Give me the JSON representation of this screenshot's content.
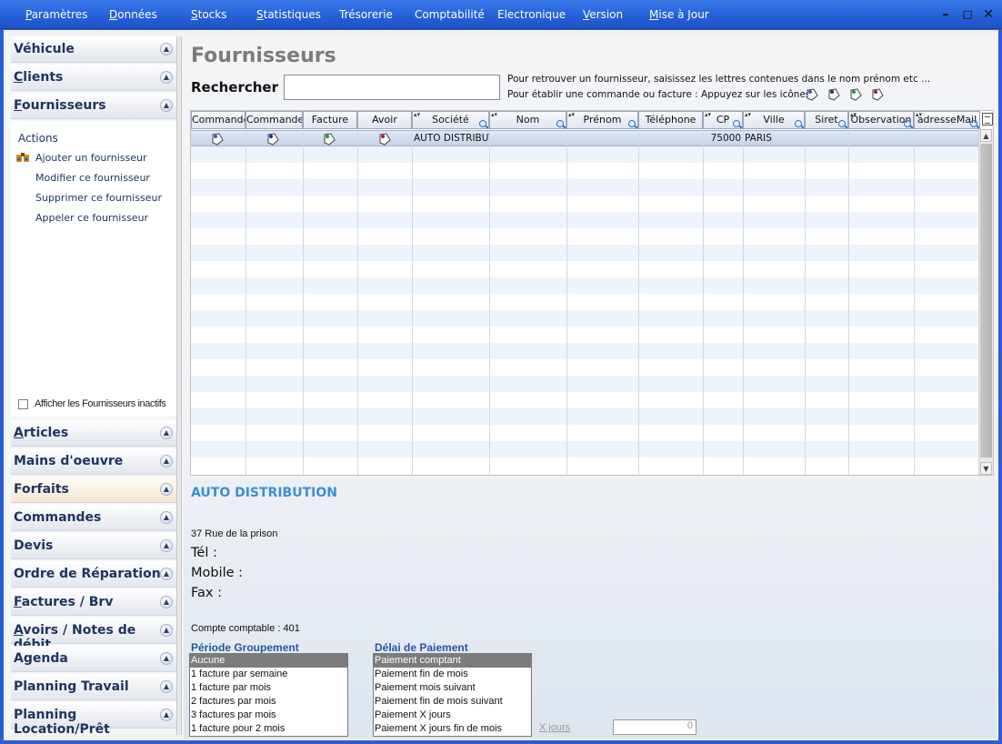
{
  "menu": {
    "items": [
      {
        "label": "Paramètres",
        "hotkey": "P",
        "rest": "aramètres"
      },
      {
        "label": "Données",
        "hotkey": "D",
        "rest": "onnées"
      },
      {
        "label": "Stocks",
        "hotkey": "S",
        "rest": "tocks"
      },
      {
        "label": "Statistiques",
        "hotkey": "S",
        "rest": "tatistiques"
      },
      {
        "label": "Trésorerie",
        "hotkey": "",
        "rest": "Trésorerie"
      },
      {
        "label": "Comptabilité",
        "hotkey": "",
        "rest": "Comptabilité"
      },
      {
        "label": "Electronique",
        "hotkey": "",
        "rest": "Electronique"
      },
      {
        "label": "Version",
        "hotkey": "V",
        "rest": "ersion"
      },
      {
        "label": "Mise à Jour",
        "hotkey": "M",
        "rest": "ise à Jour"
      }
    ],
    "window_buttons": {
      "minimize": "–",
      "maximize": "◻",
      "close": "✕"
    }
  },
  "sidebar": {
    "top_sections": [
      {
        "label": "Véhicule",
        "hotkey": "",
        "rest": "Véhicule"
      },
      {
        "label": "Clients",
        "hotkey": "C",
        "rest": "lients"
      },
      {
        "label": "Fournisseurs",
        "hotkey": "F",
        "rest": "ournisseurs"
      }
    ],
    "actions_title": "Actions",
    "actions": [
      "Ajouter un fournisseur",
      "Modifier ce fournisseur",
      "Supprimer ce fournisseur",
      "Appeler ce fournisseur"
    ],
    "inactive_checkbox_label": "Afficher les Fournisseurs inactifs",
    "bottom_sections": [
      {
        "label": "Articles",
        "hotkey": "A",
        "rest": "rticles"
      },
      {
        "label": "Mains d'oeuvre",
        "hotkey": "",
        "rest": "Mains d'oeuvre"
      },
      {
        "label": "Forfaits",
        "hotkey": "",
        "rest": "Forfaits"
      },
      {
        "label": "Commandes",
        "hotkey": "",
        "rest": "Commandes"
      },
      {
        "label": "Devis",
        "hotkey": "",
        "rest": "Devis"
      },
      {
        "label": "Ordre de Réparation",
        "hotkey": "",
        "rest": "Ordre de Réparation"
      },
      {
        "label": "Factures / Brv",
        "hotkey": "F",
        "rest": "actures / Brv"
      },
      {
        "label": "Avoirs / Notes de débit",
        "hotkey": "A",
        "rest": "voirs / Notes de débit"
      },
      {
        "label": "Agenda",
        "hotkey": "",
        "rest": "Agenda"
      },
      {
        "label": "Planning Travail",
        "hotkey": "",
        "rest": "Planning Travail"
      },
      {
        "label": "Planning Location/Prêt",
        "hotkey": "",
        "rest": "Planning Location/Prêt"
      }
    ]
  },
  "main": {
    "title": "Fournisseurs",
    "search_label": "Rechercher :",
    "search_value": "",
    "hint1": "Pour retrouver un fournisseur, saisissez les lettres contenues dans le nom prénom etc ...",
    "hint2": "Pour établir une commande ou facture : Appuyez sur les icônes",
    "table": {
      "columns": [
        "Commande",
        "Commande+",
        "Facture",
        "Avoir",
        "Société",
        "Nom",
        "Prénom",
        "Téléphone",
        "CP",
        "Ville",
        "Siret",
        "Observation",
        "adresseMail"
      ],
      "rows": [
        {
          "societe": "AUTO DISTRIBUT",
          "nom": "",
          "prenom": "",
          "telephone": "",
          "cp": "75000",
          "ville": "PARIS",
          "siret": "",
          "observation": "",
          "adresse_mail": ""
        }
      ]
    },
    "details": {
      "name": "AUTO DISTRIBUTION",
      "address": "37 Rue de la prison",
      "tel_label": "Tél :",
      "mobile_label": "Mobile :",
      "fax_label": "Fax :",
      "account": "Compte comptable : 401"
    },
    "periode": {
      "title": "Période Groupement",
      "options": [
        "Aucune",
        "1 facture par semaine",
        "1 facture par mois",
        "2 factures par mois",
        "3 factures par mois",
        "1 facture  pour 2 mois"
      ],
      "selected": "Aucune"
    },
    "delai": {
      "title": "Délai de Paiement",
      "options": [
        "Paiement comptant",
        "Paiement fin de mois",
        "Paiement mois suivant",
        "Paiement fin de mois suivant",
        "Paiement X jours",
        "Paiement X jours fin de mois"
      ],
      "selected": "Paiement comptant"
    },
    "xjours_label": "X jours",
    "xjours_value": "0"
  },
  "colors": {
    "menubar": "#245fd8",
    "accent": "#3a8fd9",
    "nav_text": "#1e3560",
    "selected_option": "#7c7c7c"
  }
}
